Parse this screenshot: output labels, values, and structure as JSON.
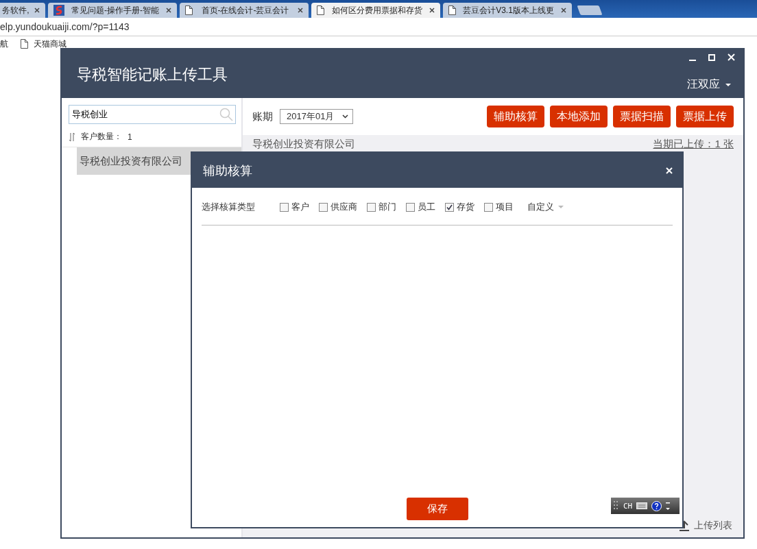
{
  "browser": {
    "tabs": [
      {
        "title": "务软件,",
        "kind": "plain",
        "selected": false
      },
      {
        "title": "常见问题-操作手册-智能",
        "kind": "logo",
        "selected": false
      },
      {
        "title": "首页-在线会计-芸豆会计",
        "kind": "page",
        "selected": false
      },
      {
        "title": "如何区分费用票据和存货",
        "kind": "page",
        "selected": true
      },
      {
        "title": "芸豆会计V3.1版本上线更",
        "kind": "page",
        "selected": false
      }
    ],
    "address": "elp.yundoukuaiji.com/?p=1143",
    "bookmarks": [
      {
        "label": "航",
        "kind": "plain"
      },
      {
        "label": "天猫商城",
        "kind": "page"
      }
    ]
  },
  "app": {
    "title": "导税智能记账上传工具",
    "user": "汪双应",
    "search": {
      "value": "导税创业"
    },
    "customer_count_label": "客户数量：",
    "customer_count": "1",
    "customers": [
      {
        "name": "导税创业投资有限公司",
        "selected": true
      }
    ],
    "period_label": "账期",
    "period": "2017年01月",
    "actions": [
      "辅助核算",
      "本地添加",
      "票据扫描",
      "票据上传"
    ],
    "company": "导税创业投资有限公司",
    "uploaded": "当期已上传：1 张",
    "upload_list": "上传列表"
  },
  "dialog": {
    "title": "辅助核算",
    "type_label": "选择核算类型",
    "types": [
      {
        "label": "客户",
        "checked": false
      },
      {
        "label": "供应商",
        "checked": false
      },
      {
        "label": "部门",
        "checked": false
      },
      {
        "label": "员工",
        "checked": false
      },
      {
        "label": "存货",
        "checked": true
      },
      {
        "label": "项目",
        "checked": false
      }
    ],
    "custom": "自定义",
    "save": "保存"
  },
  "ime": {
    "mode": "CH"
  }
}
